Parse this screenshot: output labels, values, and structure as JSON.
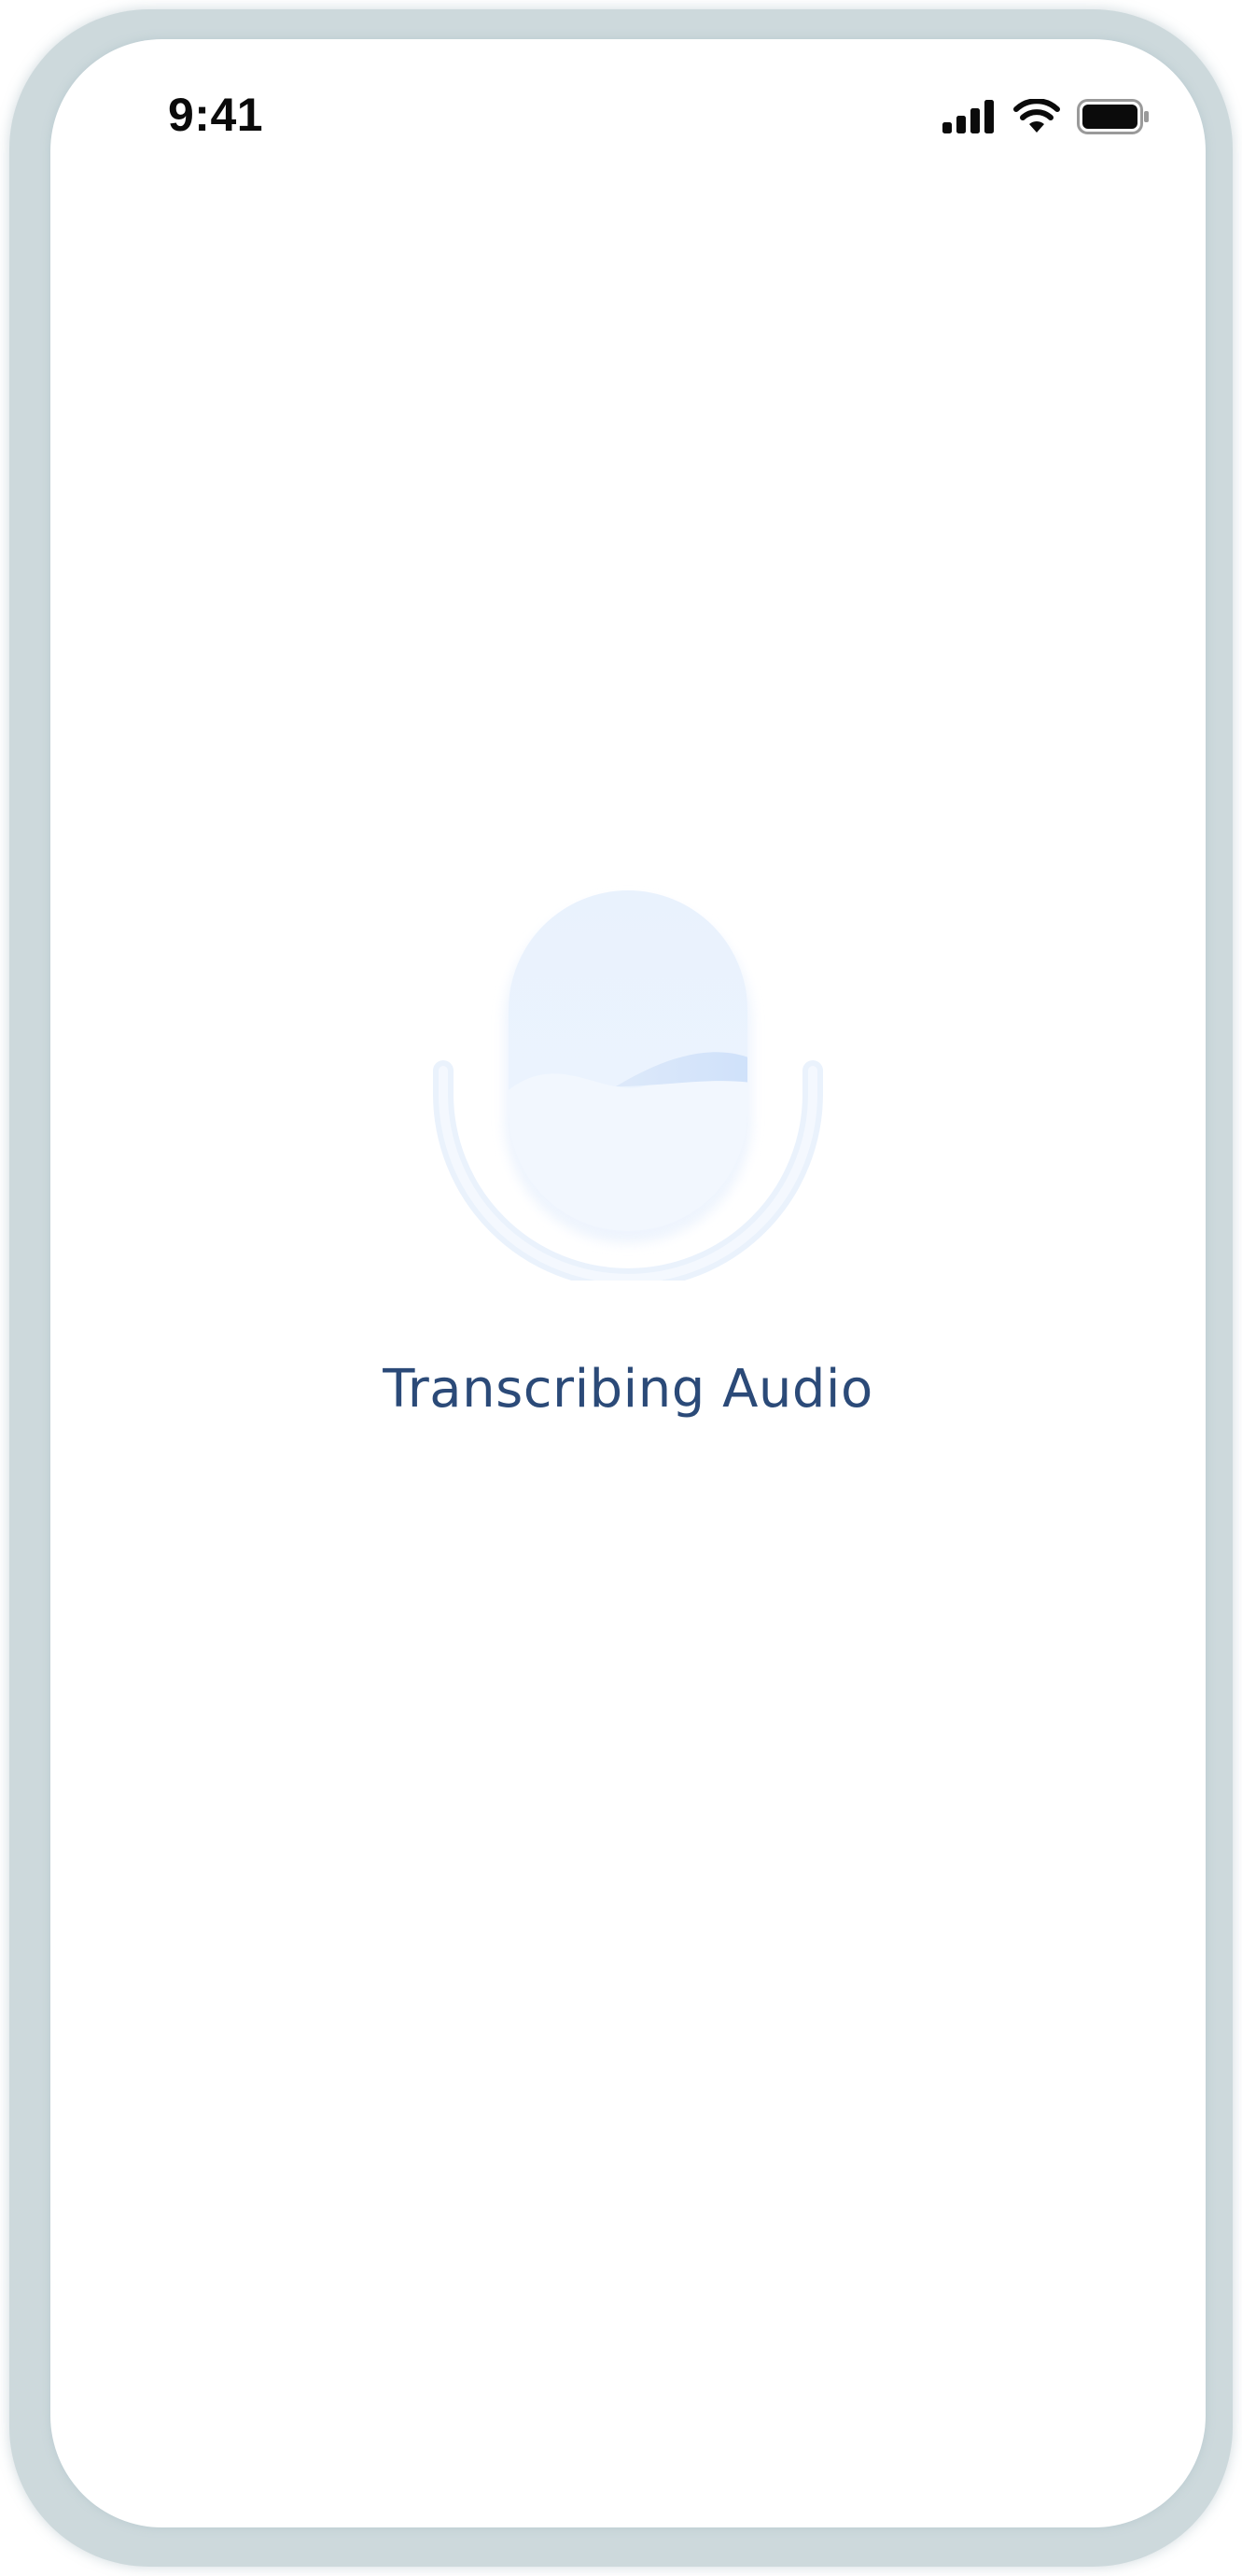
{
  "status_bar": {
    "time": "9:41",
    "icons": [
      "cellular-signal-icon",
      "wifi-icon",
      "battery-icon"
    ]
  },
  "main": {
    "illustration": "microphone-icon",
    "caption": "Transcribing Audio"
  },
  "colors": {
    "caption": "#2b4a78",
    "mic_fill": "#e8f1fd",
    "mic_wave": "#d2e4fb",
    "frame": "#cdd9dc"
  }
}
